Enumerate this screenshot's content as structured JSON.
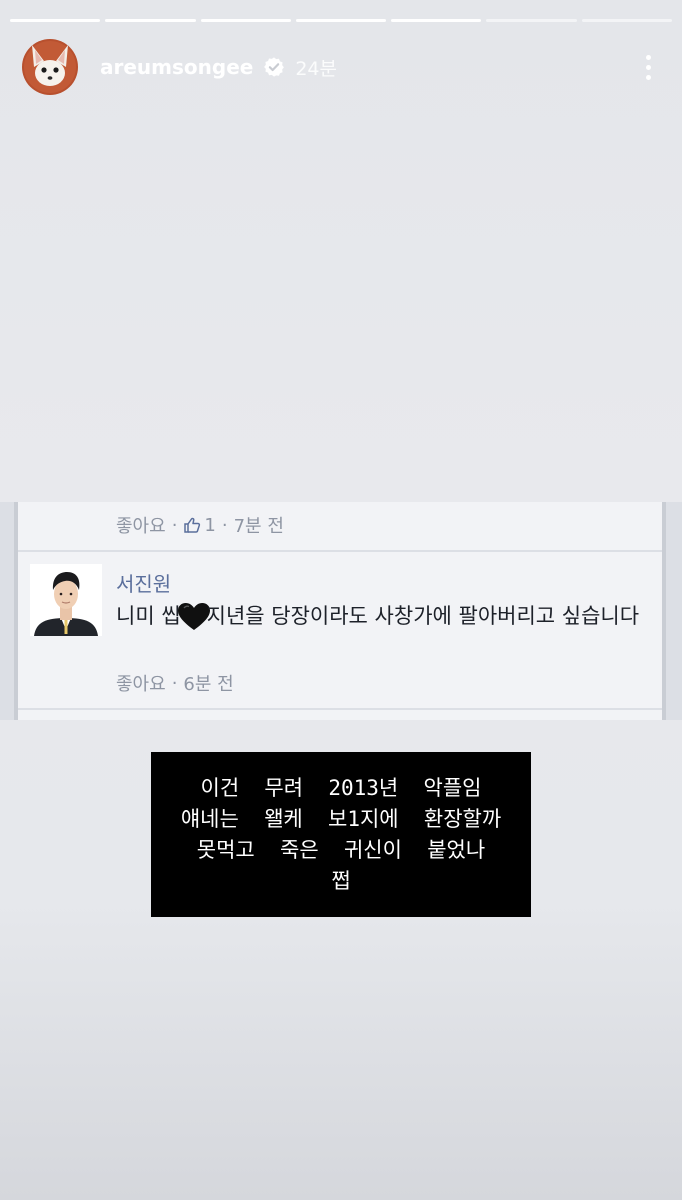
{
  "story": {
    "progress": {
      "total_segments": 7,
      "completed_segments": 5
    },
    "header": {
      "username": "areumsongee",
      "time": "24분",
      "avatar_icon": "fennec-fox-avatar",
      "verified_icon": "verified-badge-icon",
      "more_icon": "more-vertical-icon"
    },
    "screenshot": {
      "previous_comment": {
        "like_label": "좋아요",
        "like_count": "1",
        "time": "7분 전"
      },
      "comment": {
        "author": "서진원",
        "text_before_heart": "니미 씹",
        "text_after_heart": "지년을 당장이라도 사창가에 팔아버리고 싶습니다",
        "like_label": "좋아요",
        "time": "6분 전"
      }
    },
    "caption": {
      "lines": [
        "이건  무려  2013년  악플임",
        "얘네는  왤케  보1지에  환장할까",
        "못먹고  죽은  귀신이  붙었나",
        "쩝"
      ]
    }
  },
  "colors": {
    "link_blue": "#5b6f9c",
    "meta_gray": "#8e95a3",
    "caption_bg": "#000000"
  }
}
